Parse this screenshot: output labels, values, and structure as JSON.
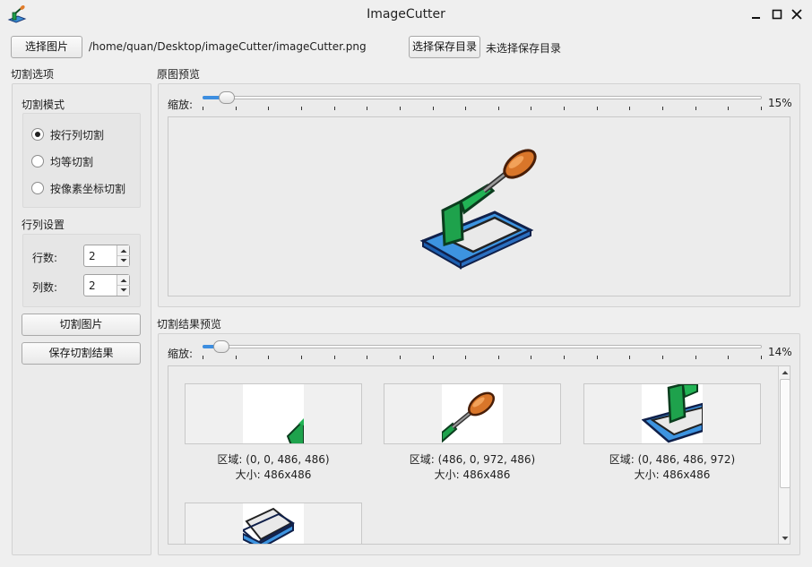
{
  "window": {
    "title": "ImageCutter",
    "icon": "imagecutter-app-icon"
  },
  "toolbar": {
    "select_image_label": "选择图片",
    "image_path": "/home/quan/Desktop/imageCutter/imageCutter.png",
    "select_save_dir_label": "选择保存目录",
    "save_dir_status": "未选择保存目录"
  },
  "options": {
    "section_title": "切割选项",
    "mode_title": "切割模式",
    "modes": [
      {
        "label": "按行列切割",
        "checked": true
      },
      {
        "label": "均等切割",
        "checked": false
      },
      {
        "label": "按像素坐标切割",
        "checked": false
      }
    ],
    "grid_title": "行列设置",
    "rows_label": "行数:",
    "rows_value": "2",
    "cols_label": "列数:",
    "cols_value": "2",
    "cut_button": "切割图片",
    "save_button": "保存切割结果"
  },
  "original_preview": {
    "title": "原图预览",
    "zoom_label": "缩放:",
    "zoom_value": "15%",
    "zoom_fraction": 0.03
  },
  "result_preview": {
    "title": "切割结果预览",
    "zoom_label": "缩放:",
    "zoom_value": "14%",
    "zoom_fraction": 0.02,
    "tiles": [
      {
        "region": "区域: (0, 0, 486, 486)",
        "size": "大小: 486x486"
      },
      {
        "region": "区域: (486, 0, 972, 486)",
        "size": "大小: 486x486"
      },
      {
        "region": "区域: (0, 486, 486, 972)",
        "size": "大小: 486x486"
      }
    ]
  }
}
